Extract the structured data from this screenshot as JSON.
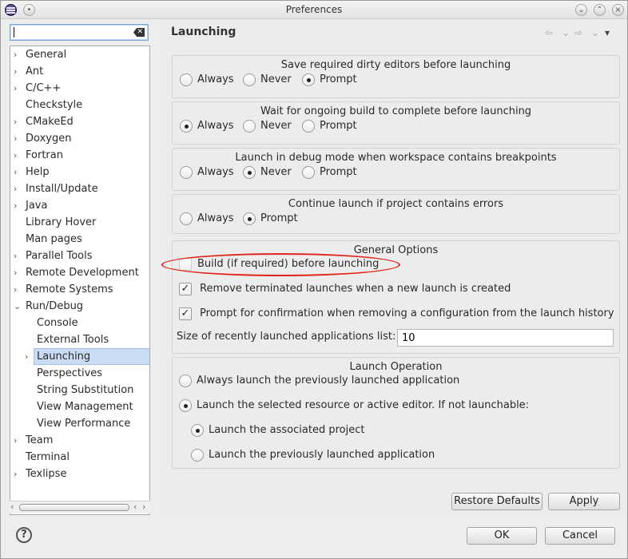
{
  "window": {
    "title": "Preferences"
  },
  "tree": {
    "filter_value": "",
    "items": [
      {
        "label": "General",
        "depth": 0,
        "arrow": ">"
      },
      {
        "label": "Ant",
        "depth": 0,
        "arrow": ">"
      },
      {
        "label": "C/C++",
        "depth": 0,
        "arrow": ">"
      },
      {
        "label": "Checkstyle",
        "depth": 0,
        "arrow": ""
      },
      {
        "label": "CMakeEd",
        "depth": 0,
        "arrow": ">"
      },
      {
        "label": "Doxygen",
        "depth": 0,
        "arrow": ">"
      },
      {
        "label": "Fortran",
        "depth": 0,
        "arrow": ">"
      },
      {
        "label": "Help",
        "depth": 0,
        "arrow": ">"
      },
      {
        "label": "Install/Update",
        "depth": 0,
        "arrow": ">"
      },
      {
        "label": "Java",
        "depth": 0,
        "arrow": ">"
      },
      {
        "label": "Library Hover",
        "depth": 0,
        "arrow": ""
      },
      {
        "label": "Man pages",
        "depth": 0,
        "arrow": ""
      },
      {
        "label": "Parallel Tools",
        "depth": 0,
        "arrow": ">"
      },
      {
        "label": "Remote Development",
        "depth": 0,
        "arrow": ">"
      },
      {
        "label": "Remote Systems",
        "depth": 0,
        "arrow": ">"
      },
      {
        "label": "Run/Debug",
        "depth": 0,
        "arrow": "v"
      },
      {
        "label": "Console",
        "depth": 1,
        "arrow": ""
      },
      {
        "label": "External Tools",
        "depth": 1,
        "arrow": ""
      },
      {
        "label": "Launching",
        "depth": 1,
        "arrow": ">",
        "selected": true
      },
      {
        "label": "Perspectives",
        "depth": 1,
        "arrow": ""
      },
      {
        "label": "String Substitution",
        "depth": 1,
        "arrow": ""
      },
      {
        "label": "View Management",
        "depth": 1,
        "arrow": ""
      },
      {
        "label": "View Performance",
        "depth": 1,
        "arrow": ""
      },
      {
        "label": "Team",
        "depth": 0,
        "arrow": ">"
      },
      {
        "label": "Terminal",
        "depth": 0,
        "arrow": ""
      },
      {
        "label": "Texlipse",
        "depth": 0,
        "arrow": ">"
      }
    ]
  },
  "page": {
    "title": "Launching",
    "groups": [
      {
        "title": "Save required dirty editors before launching",
        "options": [
          {
            "label": "Always",
            "checked": false
          },
          {
            "label": "Never",
            "checked": false
          },
          {
            "label": "Prompt",
            "checked": true
          }
        ]
      },
      {
        "title": "Wait for ongoing build to complete before launching",
        "options": [
          {
            "label": "Always",
            "checked": true
          },
          {
            "label": "Never",
            "checked": false
          },
          {
            "label": "Prompt",
            "checked": false
          }
        ]
      },
      {
        "title": "Launch in debug mode when workspace contains breakpoints",
        "options": [
          {
            "label": "Always",
            "checked": false
          },
          {
            "label": "Never",
            "checked": true
          },
          {
            "label": "Prompt",
            "checked": false
          }
        ]
      },
      {
        "title": "Continue launch if project contains errors",
        "options": [
          {
            "label": "Always",
            "checked": false
          },
          {
            "label": "Prompt",
            "checked": true
          }
        ]
      }
    ],
    "general": {
      "title": "General Options",
      "checks": [
        {
          "label": "Build (if required) before launching",
          "checked": false
        },
        {
          "label": "Remove terminated launches when a new launch is created",
          "checked": true
        },
        {
          "label": "Prompt for confirmation when removing a configuration from the launch history",
          "checked": true
        }
      ],
      "history_label": "Size of recently launched applications list:",
      "history_value": "10"
    },
    "launch_operation": {
      "title": "Launch Operation",
      "options": [
        {
          "label": "Always launch the previously launched application",
          "checked": false
        },
        {
          "label": "Launch the selected resource or active editor. If not launchable:",
          "checked": true
        },
        {
          "label": "Launch the associated project",
          "checked": true
        },
        {
          "label": "Launch the previously launched application",
          "checked": false
        }
      ]
    },
    "restore_defaults": "Restore Defaults",
    "apply": "Apply"
  },
  "footer": {
    "ok": "OK",
    "cancel": "Cancel"
  },
  "icons": {
    "help": "?",
    "clear": "x",
    "minimize": "v",
    "close": "x"
  }
}
